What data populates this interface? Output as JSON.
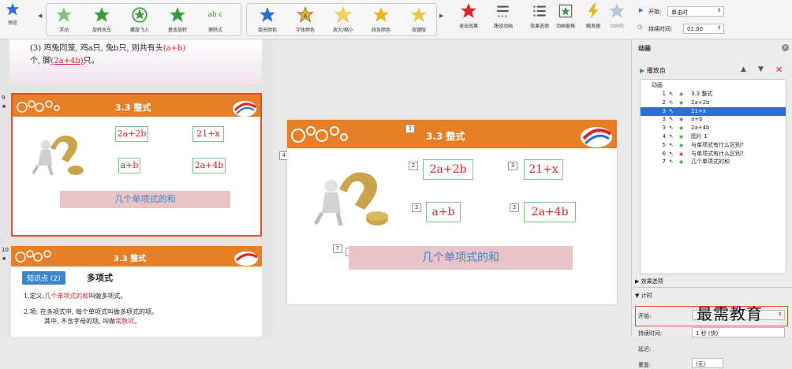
{
  "ribbon": {
    "preview": "预览",
    "effects": [
      "浮动",
      "旋转风车",
      "螺旋飞入",
      "基本旋转",
      "擦除式"
    ],
    "emphasis": [
      "填充颜色",
      "字体颜色",
      "放大/缩小",
      "线条颜色",
      "双键版"
    ],
    "actions": [
      "退出效果",
      "路径动画",
      "效果选项",
      "动画窗格",
      "触发器",
      "动画刷"
    ],
    "start_label": "开始:",
    "start_value": "单击时",
    "duration_label": "持续时间:",
    "duration_value": "01.00",
    "colors": {
      "green": "#3c9a3a",
      "red": "#d8242a",
      "yellow": "#e8b51e",
      "blue": "#2a6fd1"
    }
  },
  "top_slide": {
    "line1_prefix": "(3) 鸡兔同笼, 鸡a只, 兔b只, 则共有头",
    "line1_answer": "(a+b)",
    "line2_prefix": "个, 脚",
    "line2_answer": "(2a+4b)",
    "line2_suffix": "只。"
  },
  "thumb1": {
    "number": "9",
    "title": "3.3  整式",
    "boxes": [
      "2a+2b",
      "21+x",
      "a+b",
      "2a+4b"
    ],
    "banner": "几个单项式的和"
  },
  "thumb2": {
    "number": "10",
    "title": "3.3  整式",
    "tag": "知识点 (2)",
    "heading": "多项式",
    "p1_prefix": "1.定义:",
    "p1_red": "几个单项式的和",
    "p1_suffix": "叫做多项式。",
    "p2_line1": "2.项: 在多项式中, 每个单项式叫做多项式的项。",
    "p2_line2_prefix": "其中, 不含字母的项, 叫做",
    "p2_line2_red": "常数项",
    "p2_line2_suffix": "。"
  },
  "main_slide": {
    "title": "3.3  整式",
    "boxes": [
      "2a+2b",
      "21+x",
      "a+b",
      "2a+4b"
    ],
    "tags": [
      "1",
      "2",
      "3",
      "3",
      "3",
      "3",
      "4",
      "7",
      "1"
    ],
    "banner": "几个单项式的和"
  },
  "anim_pane": {
    "title": "动画",
    "play": "播放自",
    "col": "动画",
    "items": [
      {
        "n": "1",
        "text": "3.3 整式",
        "color": "green"
      },
      {
        "n": "2",
        "text": "2a+2b",
        "color": "green"
      },
      {
        "n": "3",
        "text": "21+x",
        "color": "green",
        "selected": true
      },
      {
        "n": "3",
        "text": "a+b",
        "color": "green"
      },
      {
        "n": "3",
        "text": "2a+4b",
        "color": "green"
      },
      {
        "n": "4",
        "text": "图片 1",
        "color": "green"
      },
      {
        "n": "5",
        "text": "与单项式有什么区别?",
        "color": "green"
      },
      {
        "n": "6",
        "text": "与单项式有什么区别?",
        "color": "red"
      },
      {
        "n": "7",
        "text": "几个单项式的和",
        "color": "green"
      }
    ],
    "effect_options": "效果选项",
    "timing": "计时",
    "start": "开始:",
    "duration": "持续时间:",
    "duration_val": "1 秒 (快)",
    "delay": "延迟:",
    "repeat": "重复:",
    "repeat_val": "(无)"
  },
  "watermark": "最需教育"
}
